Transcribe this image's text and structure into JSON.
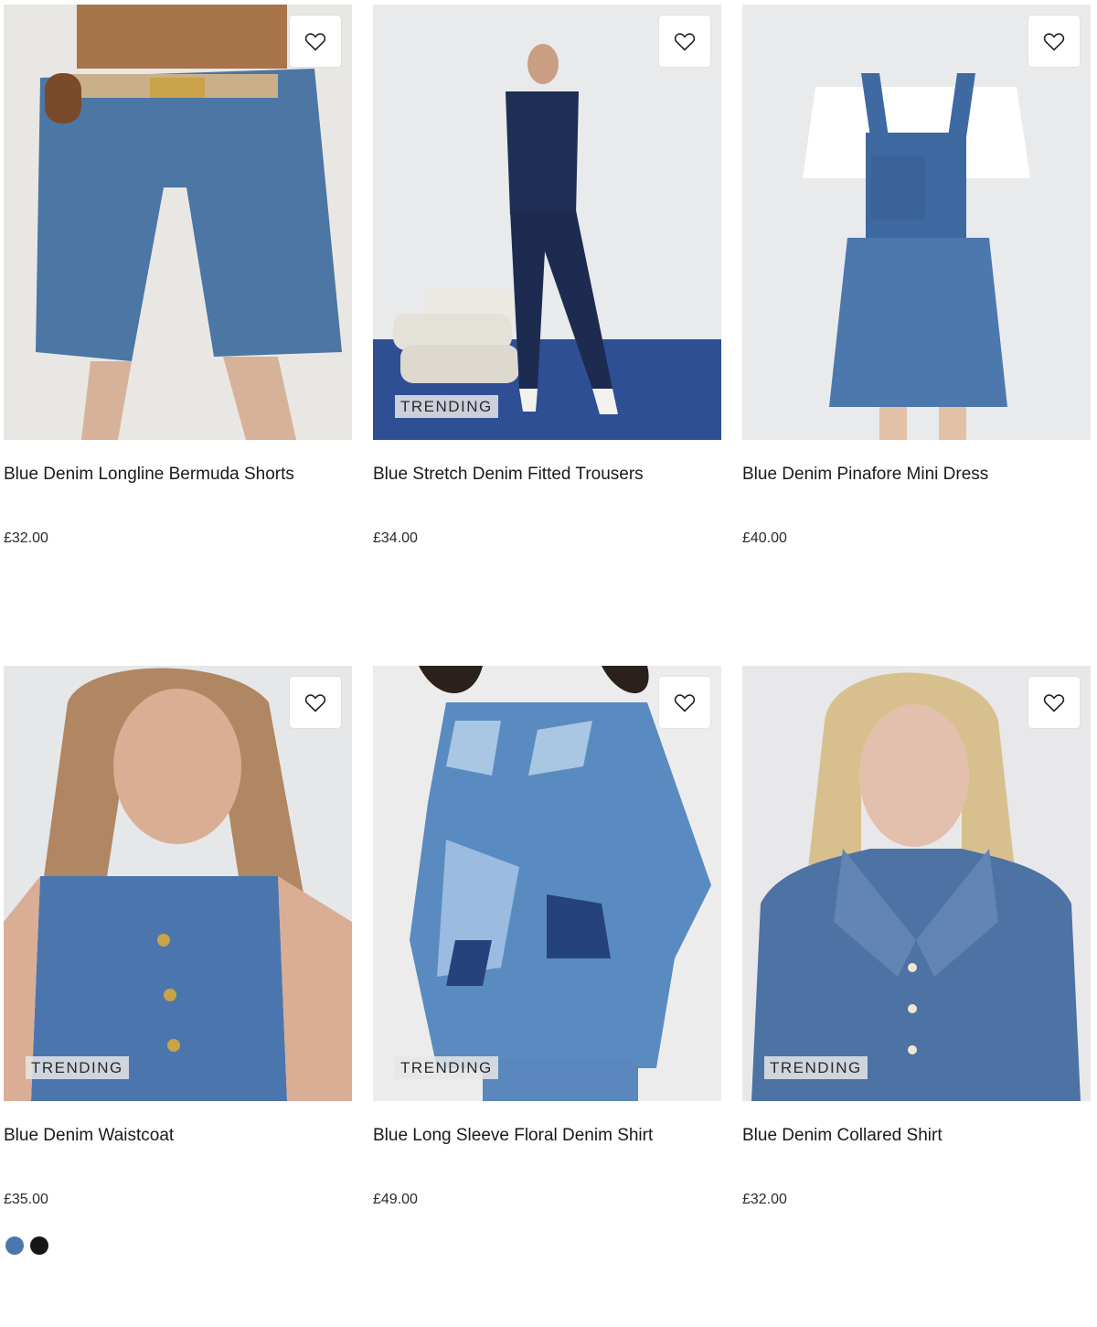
{
  "products": [
    {
      "title": "Blue Denim Longline Bermuda Shorts",
      "price": "£32.00",
      "badge": "",
      "wishlist_icon": "heart-outline-icon"
    },
    {
      "title": "Blue Stretch Denim Fitted Trousers",
      "price": "£34.00",
      "badge": "TRENDING",
      "wishlist_icon": "heart-outline-icon"
    },
    {
      "title": "Blue Denim Pinafore Mini Dress",
      "price": "£40.00",
      "badge": "",
      "wishlist_icon": "heart-outline-icon"
    },
    {
      "title": "Blue Denim Waistcoat",
      "price": "£35.00",
      "badge": "TRENDING",
      "wishlist_icon": "heart-outline-icon",
      "swatches": [
        {
          "color": "#4a77ad"
        },
        {
          "color": "#161616"
        }
      ]
    },
    {
      "title": "Blue Long Sleeve Floral Denim Shirt",
      "price": "£49.00",
      "badge": "TRENDING",
      "wishlist_icon": "heart-outline-icon"
    },
    {
      "title": "Blue Denim Collared Shirt",
      "price": "£32.00",
      "badge": "TRENDING",
      "wishlist_icon": "heart-outline-icon"
    }
  ],
  "colors": {
    "denim": "#4a72a6",
    "background": "#eeeeee",
    "text": "#1a1a1a"
  }
}
